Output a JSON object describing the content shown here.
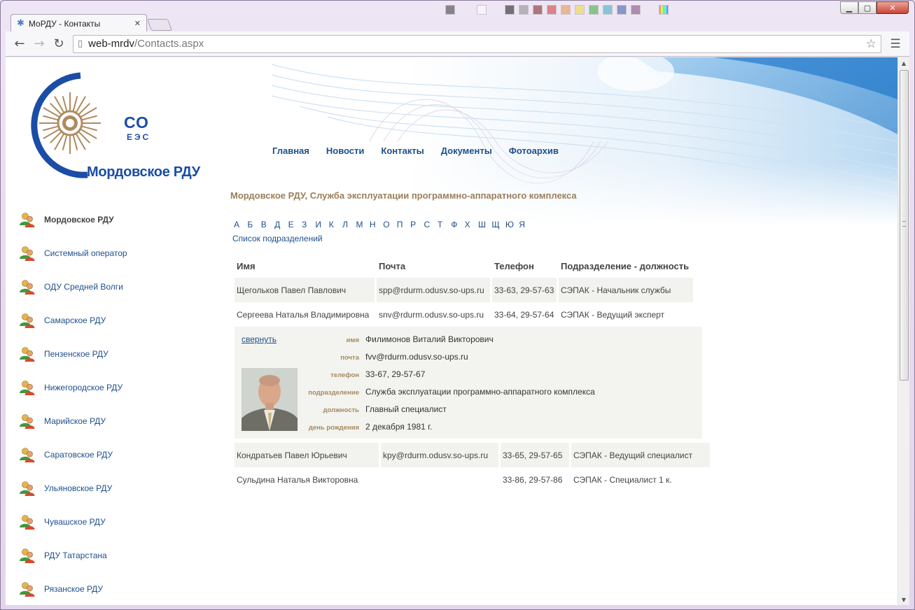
{
  "browser": {
    "tab_title": "МоРДУ - Контакты",
    "url_host": "web-mrdv",
    "url_path": "/Contacts.aspx"
  },
  "logo": {
    "co": "СО",
    "ees": "ЕЭС",
    "name": "Мордовское РДУ"
  },
  "nav": [
    "Главная",
    "Новости",
    "Контакты",
    "Документы",
    "Фотоархив"
  ],
  "sidebar": {
    "items": [
      "Мордовское РДУ",
      "Системный оператор",
      "ОДУ Средней Волги",
      "Самарское РДУ",
      "Пензенское РДУ",
      "Нижегородское РДУ",
      "Марийское РДУ",
      "Саратовское РДУ",
      "Ульяновское РДУ",
      "Чувашское РДУ",
      "РДУ Татарстана",
      "Рязанское РДУ"
    ]
  },
  "main": {
    "title": "Мордовское РДУ, Служба эксплуатации программно-аппаратного комплекса",
    "alphabet": [
      "А",
      "Б",
      "В",
      "Д",
      "Е",
      "З",
      "И",
      "К",
      "Л",
      "М",
      "Н",
      "О",
      "П",
      "Р",
      "С",
      "Т",
      "Ф",
      "Х",
      "Ш",
      "Щ",
      "Ю",
      "Я"
    ],
    "dept_list_link": "Список подразделений",
    "columns": [
      "Имя",
      "Почта",
      "Телефон",
      "Подразделение  - должность"
    ],
    "rows_top": [
      {
        "name": "Щегольков Павел Павлович",
        "email": "spp@rdurm.odusv.so-ups.ru",
        "phone": "33-63, 29-57-63",
        "position": "СЭПАК - Начальник службы"
      },
      {
        "name": "Сергеева Наталья Владимировна",
        "email": "snv@rdurm.odusv.so-ups.ru",
        "phone": "33-64, 29-57-64",
        "position": "СЭПАК - Ведущий эксперт"
      }
    ],
    "detail": {
      "collapse_link": "свернуть",
      "labels": {
        "name": "имя",
        "email": "почта",
        "phone": "телефон",
        "dept": "подразделение",
        "position": "должность",
        "birthday": "день рождения"
      },
      "values": {
        "name": "Филимонов Виталий Викторович",
        "email": "fvv@rdurm.odusv.so-ups.ru",
        "phone": "33-67, 29-57-67",
        "dept": "Служба эксплуатации программно-аппаратного комплекса",
        "position": "Главный специалист",
        "birthday": "2 декабря 1981 г."
      }
    },
    "rows_bottom": [
      {
        "name": "Кондратьев Павел Юрьевич",
        "email": "kpy@rdurm.odusv.so-ups.ru",
        "phone": "33-65, 29-57-65",
        "position": "СЭПАК - Ведущий специалист"
      },
      {
        "name": "Сульдина Наталья Викторовна",
        "email": "",
        "phone": "33-86, 29-57-86",
        "position": "СЭПАК - Специалист 1 к."
      }
    ]
  },
  "colors": {
    "link": "#1e4f8c",
    "brand": "#1b4da6",
    "title_gold": "#9a7f5a",
    "row_shade": "#f2f2ee"
  }
}
